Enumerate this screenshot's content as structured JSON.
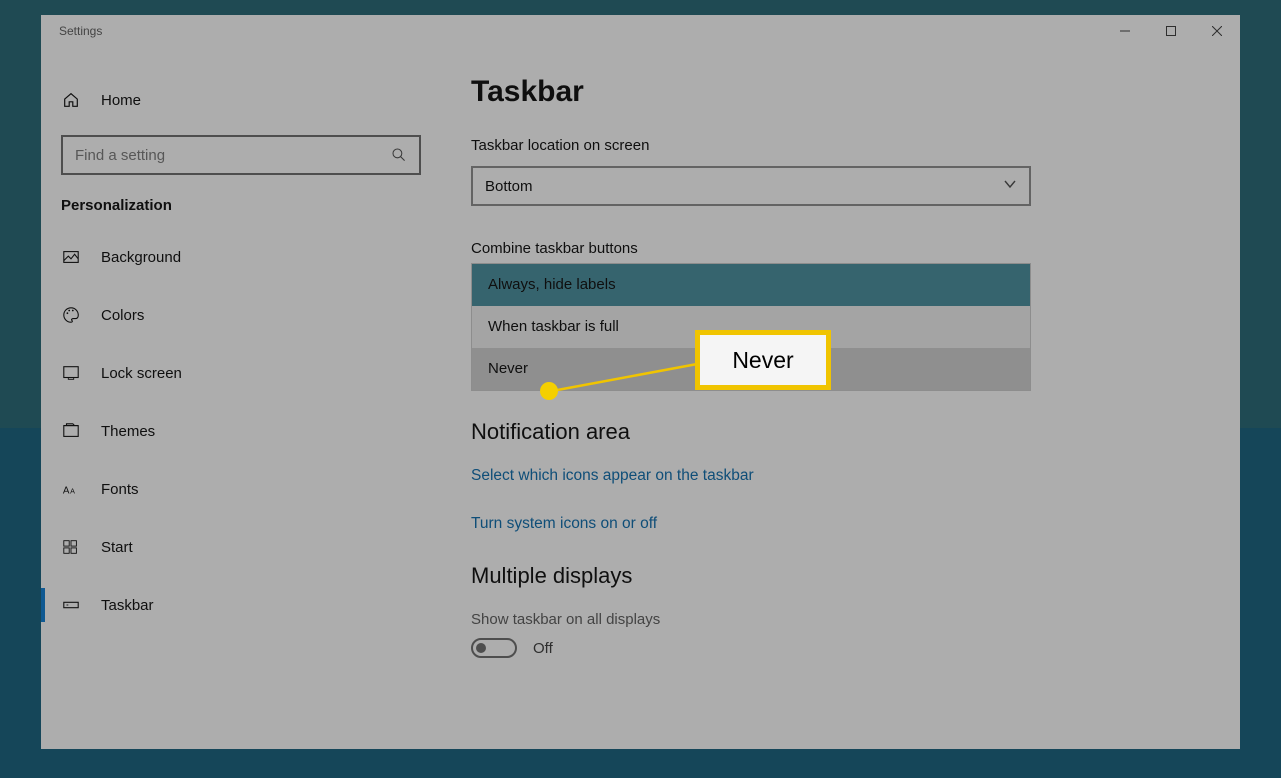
{
  "window": {
    "title": "Settings"
  },
  "sidebar": {
    "home_label": "Home",
    "search_placeholder": "Find a setting",
    "category": "Personalization",
    "items": [
      {
        "label": "Background"
      },
      {
        "label": "Colors"
      },
      {
        "label": "Lock screen"
      },
      {
        "label": "Themes"
      },
      {
        "label": "Fonts"
      },
      {
        "label": "Start"
      },
      {
        "label": "Taskbar"
      }
    ]
  },
  "main": {
    "title": "Taskbar",
    "location_label": "Taskbar location on screen",
    "location_value": "Bottom",
    "combine_label": "Combine taskbar buttons",
    "combine_options": [
      "Always, hide labels",
      "When taskbar is full",
      "Never"
    ],
    "notification_header": "Notification area",
    "link_icons": "Select which icons appear on the taskbar",
    "link_system": "Turn system icons on or off",
    "multiple_header": "Multiple displays",
    "show_all_label": "Show taskbar on all displays",
    "show_all_value": "Off"
  },
  "callout": {
    "text": "Never"
  }
}
